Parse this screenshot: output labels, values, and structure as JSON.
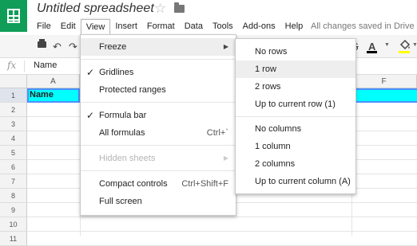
{
  "header": {
    "title": "Untitled spreadsheet",
    "star_icon": "star-outline-icon",
    "folder_icon": "folder-icon",
    "save_status": "All changes saved in Drive"
  },
  "menubar": [
    "File",
    "Edit",
    "View",
    "Insert",
    "Format",
    "Data",
    "Tools",
    "Add-ons",
    "Help"
  ],
  "toolbar": {
    "print_icon": "print-icon",
    "undo": "↶",
    "redo": "↷",
    "strike": "S",
    "text_color_label": "A",
    "text_color": "#000000",
    "fill_color": "#ffff00"
  },
  "formula_bar": {
    "fx": "fx",
    "value": "Name"
  },
  "grid": {
    "columns": [
      "A",
      "F"
    ],
    "rows": [
      "1",
      "2",
      "3",
      "4",
      "5",
      "6",
      "7",
      "8",
      "9",
      "10",
      "11"
    ],
    "a1": "Name",
    "row1_fill": "#00ffff"
  },
  "view_menu": {
    "freeze": "Freeze",
    "gridlines": "Gridlines",
    "protected_ranges": "Protected ranges",
    "formula_bar": "Formula bar",
    "all_formulas": "All formulas",
    "all_formulas_shortcut": "Ctrl+`",
    "hidden_sheets": "Hidden sheets",
    "compact_controls": "Compact controls",
    "compact_controls_shortcut": "Ctrl+Shift+F",
    "full_screen": "Full screen",
    "check": "✓",
    "arrow": "▶"
  },
  "freeze_menu": {
    "no_rows": "No rows",
    "one_row": "1 row",
    "two_rows": "2 rows",
    "up_to_row": "Up to current row (1)",
    "no_columns": "No columns",
    "one_column": "1 column",
    "two_columns": "2 columns",
    "up_to_column": "Up to current column (A)"
  }
}
